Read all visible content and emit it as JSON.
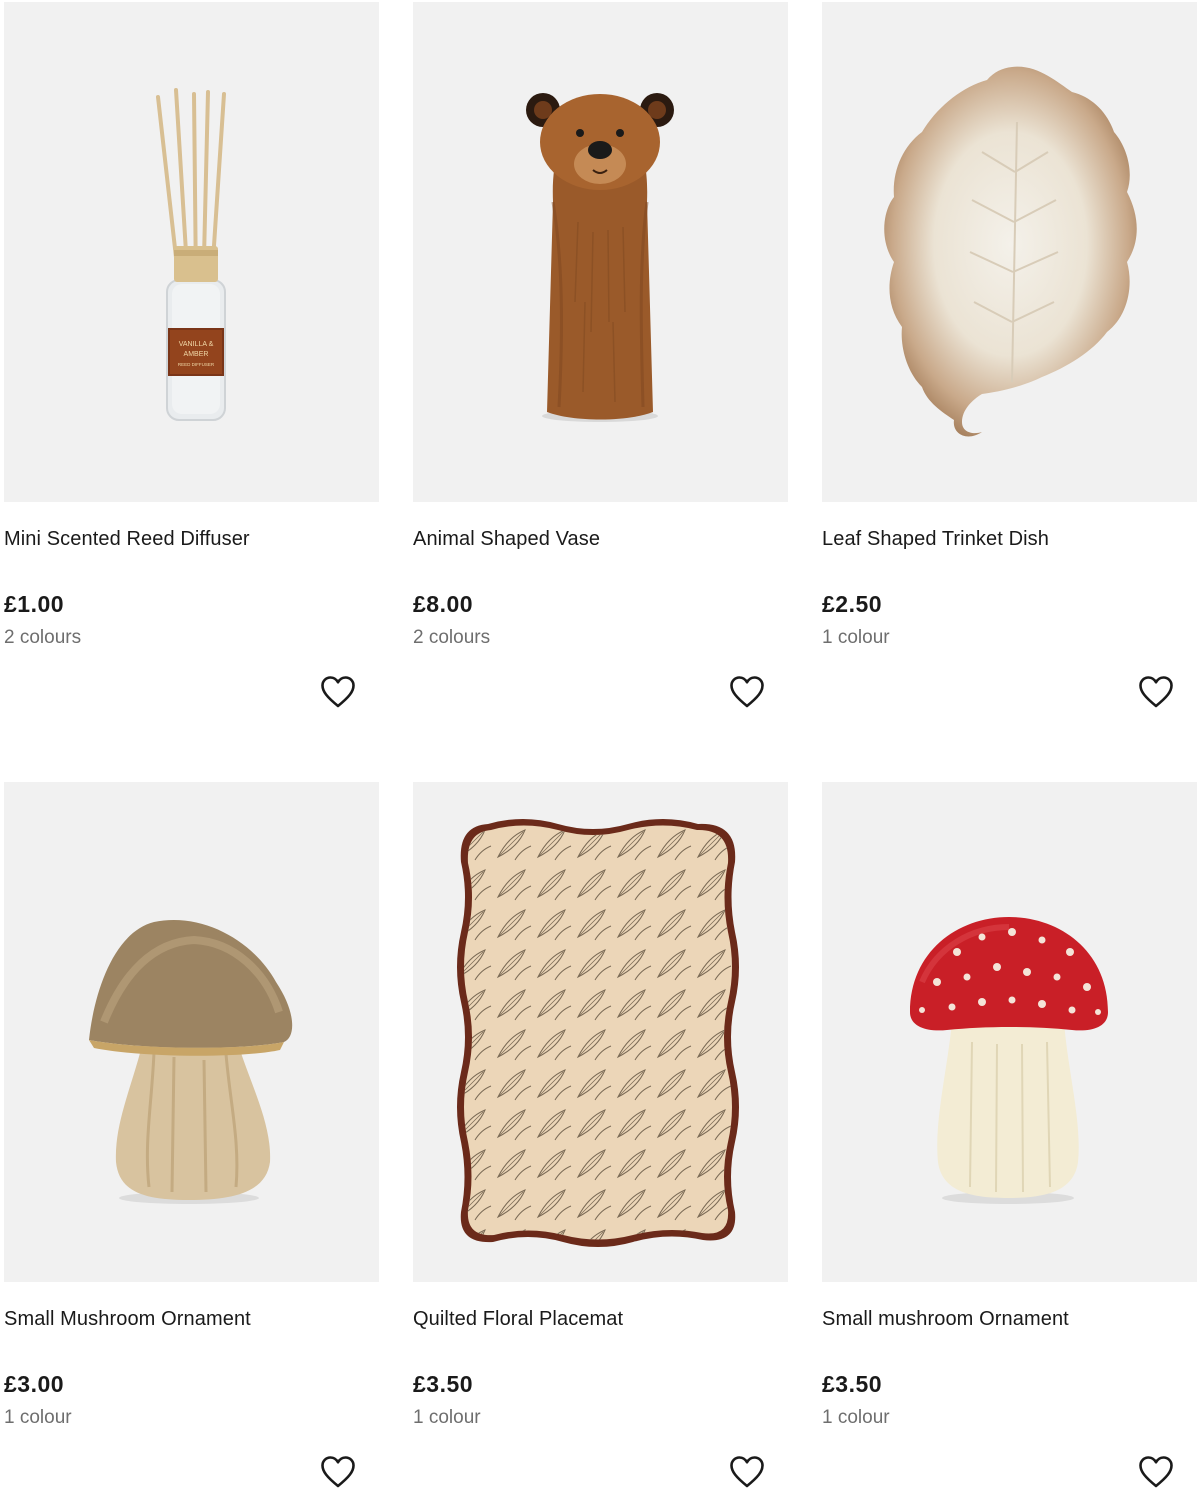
{
  "products": [
    {
      "title": "Mini Scented Reed Diffuser",
      "price": "£1.00",
      "colours": "2 colours",
      "image_icon": "reed-diffuser-image",
      "label_line1": "VANILLA &",
      "label_line2": "AMBER",
      "label_line3": "REED DIFFUSER"
    },
    {
      "title": "Animal Shaped Vase",
      "price": "£8.00",
      "colours": "2 colours",
      "image_icon": "bear-vase-image"
    },
    {
      "title": "Leaf Shaped Trinket Dish",
      "price": "£2.50",
      "colours": "1 colour",
      "image_icon": "leaf-dish-image"
    },
    {
      "title": "Small Mushroom Ornament",
      "price": "£3.00",
      "colours": "1 colour",
      "image_icon": "brown-mushroom-image"
    },
    {
      "title": "Quilted Floral Placemat",
      "price": "£3.50",
      "colours": "1 colour",
      "image_icon": "placemat-image"
    },
    {
      "title": "Small mushroom Ornament",
      "price": "£3.50",
      "colours": "1 colour",
      "image_icon": "red-mushroom-image"
    }
  ],
  "colors": {
    "image_bg": "#f1f1f1",
    "text": "#1a1a1a",
    "muted_text": "#6e6e6e"
  },
  "wishlist_icon": "heart-outline-icon"
}
